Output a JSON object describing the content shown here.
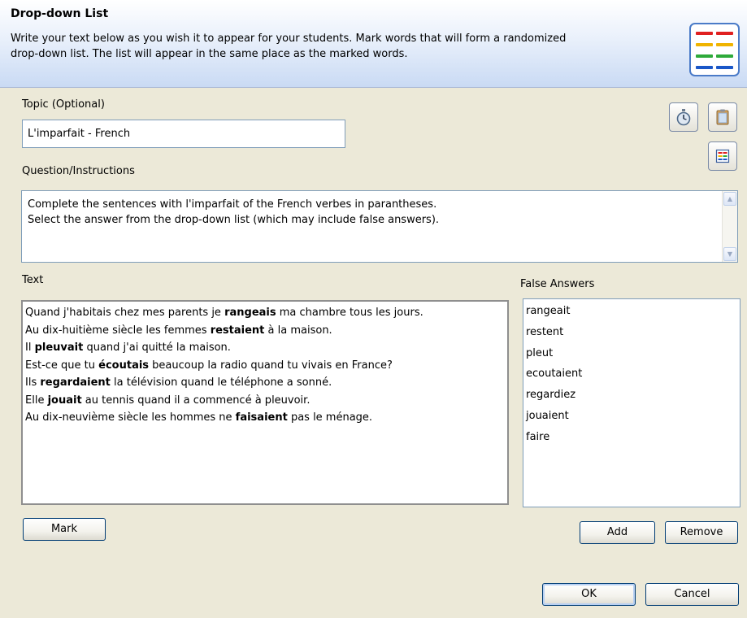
{
  "header": {
    "title": "Drop-down List",
    "description_line1": "Write your text below as you wish it to appear for your students. Mark words that will form a randomized",
    "description_line2": "drop-down list. The list will appear in the same place as the marked words.",
    "icon": "dropdown-list-icon",
    "icon_colors": [
      "#e02020",
      "#f0b400",
      "#2eaa3a",
      "#1a57c8"
    ]
  },
  "topic": {
    "label": "Topic (Optional)",
    "value": "L'imparfait - French"
  },
  "tools": {
    "timer_icon": "stopwatch-icon",
    "clipboard_icon": "clipboard-icon",
    "list_icon": "list-view-icon"
  },
  "question": {
    "label": "Question/Instructions",
    "line1": "Complete the sentences with l'imparfait of the French verbes in parantheses.",
    "line2": "Select the answer from the drop-down list (which may include false answers)."
  },
  "text_section": {
    "label": "Text",
    "lines": [
      {
        "before": "Quand j'habitais chez mes parents je ",
        "bold": "rangeais",
        "after": " ma chambre tous les jours."
      },
      {
        "before": "Au dix-huitième siècle les femmes ",
        "bold": "restaient",
        "after": " à la maison."
      },
      {
        "before": "Il ",
        "bold": "pleuvait",
        "after": " quand j'ai quitté la maison."
      },
      {
        "before": "Est-ce que tu ",
        "bold": "écoutais",
        "after": " beaucoup la radio quand tu vivais en France?"
      },
      {
        "before": "Ils ",
        "bold": "regardaient",
        "after": " la télévision quand le téléphone a sonné."
      },
      {
        "before": "Elle ",
        "bold": "jouait",
        "after": " au tennis quand il a commencé à pleuvoir."
      },
      {
        "before": "Au dix-neuvième siècle les hommes ne ",
        "bold": "faisaient",
        "after": " pas le ménage."
      }
    ]
  },
  "false_answers": {
    "label": "False Answers",
    "items": [
      "rangeait",
      "restent",
      "pleut",
      "ecoutaient",
      "regardiez",
      "jouaient",
      "faire"
    ]
  },
  "buttons": {
    "mark": "Mark",
    "add": "Add",
    "remove": "Remove",
    "ok": "OK",
    "cancel": "Cancel"
  }
}
